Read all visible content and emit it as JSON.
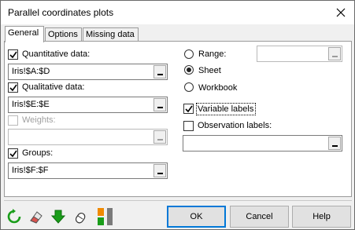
{
  "window": {
    "title": "Parallel coordinates plots"
  },
  "tabs": [
    {
      "label": "General",
      "active": true
    },
    {
      "label": "Options",
      "active": false
    },
    {
      "label": "Missing data",
      "active": false
    }
  ],
  "general": {
    "quantitative": {
      "label": "Quantitative data:",
      "checked": true,
      "value": "Iris!$A:$D"
    },
    "qualitative": {
      "label": "Qualitative data:",
      "checked": true,
      "value": "Iris!$E:$E"
    },
    "weights": {
      "label": "Weights:",
      "checked": false,
      "enabled": false,
      "value": ""
    },
    "groups": {
      "label": "Groups:",
      "checked": true,
      "value": "Iris!$F:$F"
    },
    "output": {
      "range_label": "Range:",
      "range_value": "",
      "sheet_label": "Sheet",
      "workbook_label": "Workbook",
      "selected": "Sheet"
    },
    "variable_labels": {
      "label": "Variable labels",
      "checked": true
    },
    "observation_labels": {
      "label": "Observation labels:",
      "checked": false,
      "value": ""
    }
  },
  "footer": {
    "ok_label": "OK",
    "cancel_label": "Cancel",
    "help_label": "Help"
  },
  "icons": [
    "reset-icon",
    "eraser-icon",
    "down-arrow-icon",
    "mouse-icon",
    "layout-toggle-icon"
  ],
  "colors": {
    "accent": "#0078d7",
    "green": "#1a9d1a",
    "orange": "#f08a00"
  }
}
